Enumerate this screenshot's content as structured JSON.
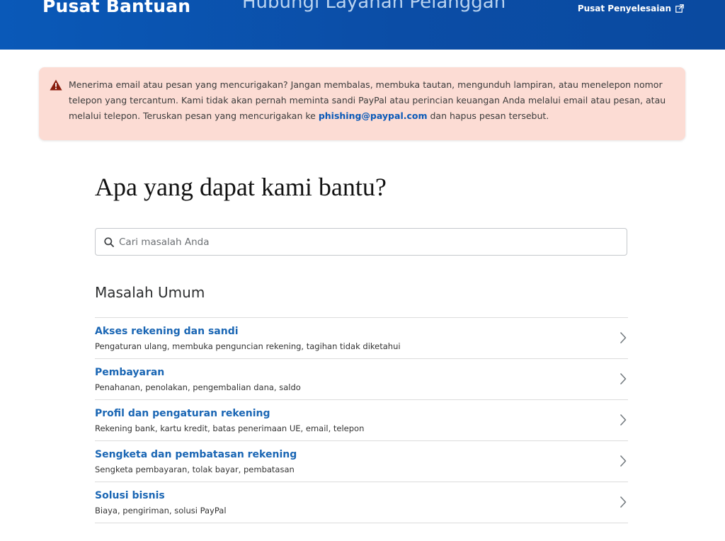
{
  "header": {
    "brand": "Pusat Bantuan",
    "center_title": "Hubungi Layanan Pelanggan",
    "resolution_link": "Pusat Penyelesaian"
  },
  "alert": {
    "text_before": "Menerima email atau pesan yang mencurigakan? Jangan membalas, membuka tautan, mengunduh lampiran, atau menelepon nomor telepon yang tercantum. Kami tidak akan pernah meminta sandi PayPal atau perincian keuangan Anda melalui email atau pesan, atau melalui telepon. Teruskan pesan yang mencurigakan ke ",
    "email_link": "phishing@paypal.com",
    "text_after": " dan hapus pesan tersebut."
  },
  "main": {
    "title": "Apa yang dapat kami bantu?",
    "search_placeholder": "Cari masalah Anda",
    "section_title": "Masalah Umum",
    "issues": [
      {
        "title": "Akses rekening dan sandi",
        "desc": "Pengaturan ulang, membuka penguncian rekening, tagihan tidak diketahui"
      },
      {
        "title": "Pembayaran",
        "desc": "Penahanan, penolakan, pengembalian dana, saldo"
      },
      {
        "title": "Profil dan pengaturan rekening",
        "desc": "Rekening bank, kartu kredit, batas penerimaan UE, email, telepon"
      },
      {
        "title": "Sengketa dan pembatasan rekening",
        "desc": "Sengketa pembayaran, tolak bayar, pembatasan"
      },
      {
        "title": "Solusi bisnis",
        "desc": "Biaya, pengiriman, solusi PayPal"
      }
    ]
  },
  "icons": {
    "warning": "warning-triangle-icon",
    "external": "external-link-icon",
    "search": "search-icon",
    "chevron": "chevron-right-icon"
  },
  "colors": {
    "header_blue": "#0a59b8",
    "link_blue": "#1a66b4",
    "alert_bg": "#fcdcd4",
    "warning_red": "#8a1d0d"
  }
}
